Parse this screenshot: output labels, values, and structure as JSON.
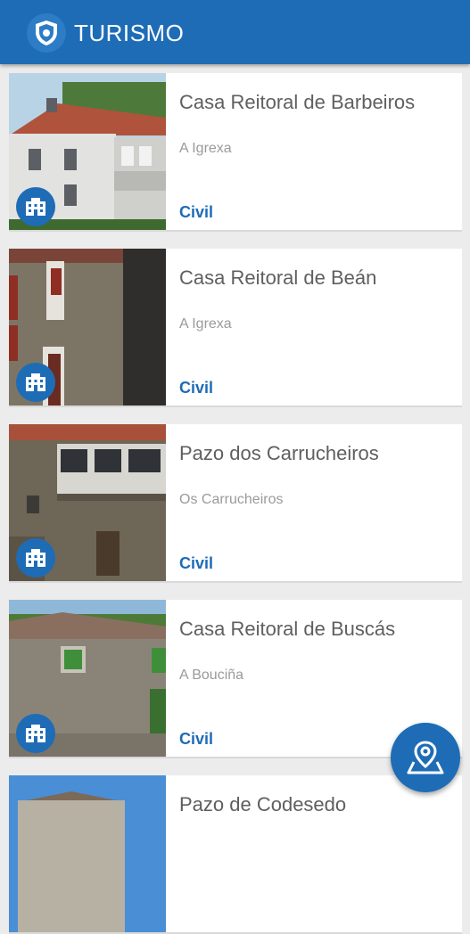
{
  "header": {
    "title": "TURISMO",
    "logo_icon": "shield-icon",
    "background": "#1e6cb6"
  },
  "items": [
    {
      "name": "Casa Reitoral de Barbeiros",
      "place": "A Igrexa",
      "category": "Civil",
      "category_icon": "building-icon"
    },
    {
      "name": "Casa Reitoral de Beán",
      "place": "A Igrexa",
      "category": "Civil",
      "category_icon": "building-icon"
    },
    {
      "name": "Pazo dos Carrucheiros",
      "place": "Os Carrucheiros",
      "category": "Civil",
      "category_icon": "building-icon"
    },
    {
      "name": "Casa Reitoral de Buscás",
      "place": "A Bouciña",
      "category": "Civil",
      "category_icon": "building-icon"
    },
    {
      "name": "Pazo de Codesedo",
      "place": "",
      "category": "",
      "category_icon": "building-icon"
    }
  ],
  "fab": {
    "icon": "map-pin-icon"
  }
}
